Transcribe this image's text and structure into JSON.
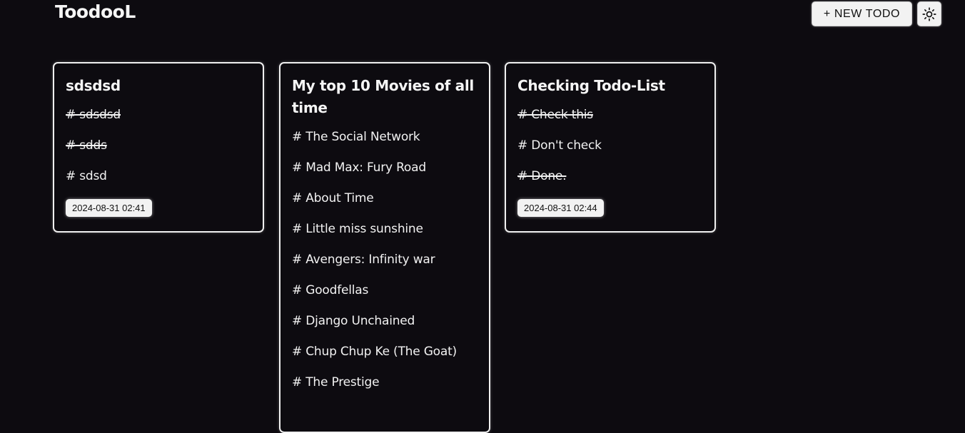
{
  "header": {
    "brand": "ToodooL",
    "new_todo_label": "+ NEW TODO",
    "theme_toggle_icon": "sun-icon"
  },
  "cards": [
    {
      "title": "sdsdsd",
      "items": [
        {
          "text": "# sdsdsd",
          "done": true
        },
        {
          "text": "# sdds",
          "done": true
        },
        {
          "text": "# sdsd",
          "done": false
        }
      ],
      "timestamp": "2024-08-31 02:41"
    },
    {
      "title": "My top 10 Movies of all time",
      "items": [
        {
          "text": "# The Social Network",
          "done": false
        },
        {
          "text": "# Mad Max: Fury Road",
          "done": false
        },
        {
          "text": "# About Time",
          "done": false
        },
        {
          "text": "# Little miss sunshine",
          "done": false
        },
        {
          "text": "# Avengers: Infinity war",
          "done": false
        },
        {
          "text": "# Goodfellas",
          "done": false
        },
        {
          "text": "# Django Unchained",
          "done": false
        },
        {
          "text": "# Chup Chup Ke (The Goat)",
          "done": false
        },
        {
          "text": "# The Prestige",
          "done": false
        }
      ],
      "timestamp": ""
    },
    {
      "title": "Checking Todo-List",
      "items": [
        {
          "text": "# Check this",
          "done": true
        },
        {
          "text": "# Don't check",
          "done": false
        },
        {
          "text": "# Done.",
          "done": true
        }
      ],
      "timestamp": "2024-08-31 02:44"
    }
  ],
  "colors": {
    "background": "#0d0b10",
    "text": "#f2f2f2",
    "button_bg": "#f2f2f2"
  }
}
